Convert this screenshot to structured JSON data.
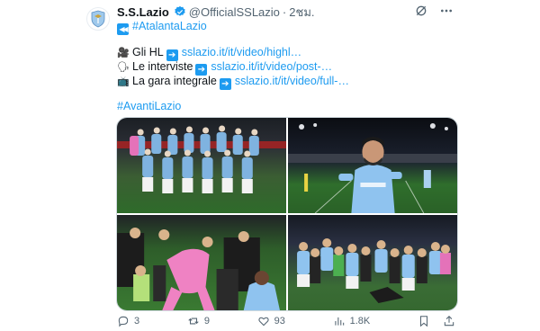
{
  "tweet": {
    "author_name": "S.S.Lazio",
    "handle": "@OfficialSSLazio",
    "separator": "·",
    "time": "2ชม.",
    "hashtag_top": "#AtalantaLazio",
    "lines": [
      {
        "label": "Gli HL",
        "link": "sslazio.it/it/video/highl…"
      },
      {
        "label": "Le interviste",
        "link": "sslazio.it/it/video/post-…"
      },
      {
        "label": "La gara integrale",
        "link": "sslazio.it/it/video/full-…"
      }
    ],
    "hashtag_bottom": "#AvantiLazio",
    "photos": [
      "team-photo",
      "player-celebration",
      "goalkeeper-celebration",
      "crowd-celebration"
    ]
  },
  "actions": {
    "replies": "3",
    "reposts": "9",
    "likes": "93",
    "views": "1.8K"
  },
  "colors": {
    "accent": "#1d9bf0",
    "muted": "#536471",
    "text": "#0f1419",
    "lazio_blue": "#7fb3e0"
  },
  "icons": [
    "lazio-logo-icon",
    "verified-icon",
    "grok-icon",
    "more-icon",
    "video-camera-icon",
    "speaking-head-icon",
    "tv-icon",
    "arrow-right-icon",
    "rewind-icon",
    "reply-icon",
    "repost-icon",
    "like-icon",
    "views-icon",
    "bookmark-icon",
    "share-icon"
  ]
}
